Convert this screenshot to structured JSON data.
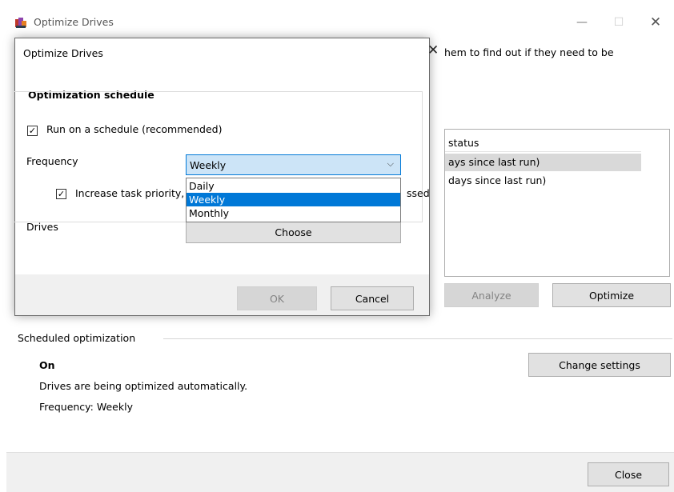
{
  "window": {
    "title": "Optimize Drives",
    "minimize": "—",
    "maximize": "☐",
    "close": "✕"
  },
  "main": {
    "description_fragment": "hem to find out if they need to be",
    "list_header": "status",
    "list_rows": [
      "ays since last run)",
      "days since last run)"
    ],
    "analyze_label": "Analyze",
    "optimize_label": "Optimize"
  },
  "scheduled": {
    "section_label": "Scheduled optimization",
    "status": "On",
    "description": "Drives are being optimized automatically.",
    "frequency_text": "Frequency: Weekly",
    "change_settings_label": "Change settings"
  },
  "footer": {
    "close_label": "Close"
  },
  "dialog": {
    "title": "Optimize Drives",
    "close": "✕",
    "schedule_heading": "Optimization schedule",
    "run_on_schedule_label": "Run on a schedule (recommended)",
    "run_on_schedule_checked": true,
    "frequency_label": "Frequency",
    "frequency_value": "Weekly",
    "frequency_options": [
      "Daily",
      "Weekly",
      "Monthly"
    ],
    "increase_priority_label": "Increase task priority,",
    "increase_priority_tail": "ssed",
    "increase_priority_checked": true,
    "drives_label": "Drives",
    "choose_label": "Choose",
    "ok_label": "OK",
    "cancel_label": "Cancel"
  },
  "icons": {
    "app": "defrag-icon",
    "check": "✓",
    "chevron": "⌵"
  },
  "colors": {
    "accent": "#0078d7",
    "selection_bg": "#cce4f7",
    "disabled_text": "#838383"
  }
}
